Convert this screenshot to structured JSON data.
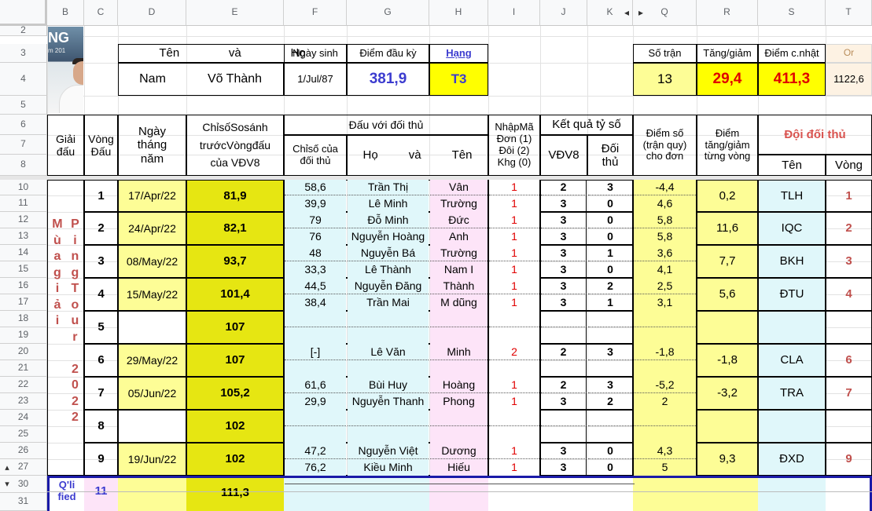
{
  "colors": {
    "yellow": "#ffff00",
    "light_yellow": "#fdfd96",
    "gold": "#e6e612",
    "cyan": "#e0f7fa",
    "peach": "#fdf2e3",
    "pink": "#fde4f8",
    "red": "#e00000",
    "blue": "#3c3ccf",
    "maroon": "#c0504d",
    "frozen_line": "#cccccc",
    "selection": "#1a1aa8"
  },
  "columns": [
    "B",
    "C",
    "D",
    "E",
    "F",
    "G",
    "H",
    "I",
    "J",
    "K",
    "Q",
    "R",
    "S",
    "T"
  ],
  "rows": [
    "2",
    "3",
    "4",
    "5",
    "6",
    "7",
    "8",
    "10",
    "11",
    "12",
    "13",
    "14",
    "15",
    "16",
    "17",
    "18",
    "19",
    "20",
    "21",
    "22",
    "23",
    "24",
    "25",
    "26",
    "27",
    "30",
    "31"
  ],
  "icons": {
    "hidden_cols_left": "◂",
    "hidden_cols_right": "▸",
    "row_group_expand": "▴",
    "row_group_collapse": "▾"
  },
  "player": {
    "photo_text": "NG",
    "photo_sub": "m 201",
    "name_label": "Tên",
    "and_label": "và",
    "surname_label": "Họ",
    "name": "Nam",
    "surname": "Võ Thành",
    "dob_label": "Ngày sinh",
    "dob": "1/Jul/87",
    "start_points_label": "Điểm đầu kỳ",
    "start_points": "381,9",
    "rank_label": "Hạng",
    "rank": "T3"
  },
  "summary": {
    "matches_label": "Số trận",
    "matches": "13",
    "change_label": "Tăng/giảm",
    "change": "29,4",
    "updated_label": "Điểm c.nhật",
    "updated": "411,3",
    "or_label": "Or",
    "or_value": "1122,6"
  },
  "headers": {
    "tournament": "Giải đấu",
    "round": "Vòng Đấu",
    "date": "Ngày tháng năm",
    "index": "ChỉsốSosánh trướcVòngđấu của VĐV8",
    "vs_opponent": "Đấu với đối thủ",
    "opp_index": "Chỉsố của đối thủ",
    "ho": "Họ",
    "va": "và",
    "ten": "Tên",
    "input_code": "NhậpMã Đơn (1) Đôi (2) Khg (0)",
    "result": "Kết quả tỷ số",
    "vdv8": "VĐV8",
    "opp": "Đối thủ",
    "points": "Điểm số (trận quy) cho đơn",
    "per_round": "Điểm tăng/giảm từng vòng",
    "opp_team": "Đội đối thủ",
    "team_name": "Tên",
    "team_round": "Vòng"
  },
  "tournament_letters": [
    "M",
    "ù",
    "a",
    "g",
    "i",
    "ả",
    "i"
  ],
  "tournament_letters2": [
    "P",
    "i",
    "n",
    "g",
    "T",
    "o",
    "u",
    "r",
    "",
    "2",
    "0",
    "2",
    "2"
  ],
  "qualified_label": "Q'li fied",
  "qualified_round": "11",
  "qualified_index": "111,3",
  "rounds": [
    {
      "round": "1",
      "date": "17/Apr/22",
      "index": "81,9",
      "change": "0,2",
      "team": "TLH",
      "team_round": "1",
      "matches": [
        {
          "opp_index": "58,6",
          "ho": "Trần Thị",
          "ten": "Vân",
          "code": "1",
          "a": "2",
          "b": "3",
          "pts": "-4,4"
        },
        {
          "opp_index": "39,9",
          "ho": "Lê Minh",
          "ten": "Trường",
          "code": "1",
          "a": "3",
          "b": "0",
          "pts": "4,6"
        }
      ]
    },
    {
      "round": "2",
      "date": "24/Apr/22",
      "index": "82,1",
      "change": "11,6",
      "team": "IQC",
      "team_round": "2",
      "matches": [
        {
          "opp_index": "79",
          "ho": "Đỗ Minh",
          "ten": "Đức",
          "code": "1",
          "a": "3",
          "b": "0",
          "pts": "5,8"
        },
        {
          "opp_index": "76",
          "ho": "Nguyễn Hoàng",
          "ten": "Anh",
          "code": "1",
          "a": "3",
          "b": "0",
          "pts": "5,8"
        }
      ]
    },
    {
      "round": "3",
      "date": "08/May/22",
      "index": "93,7",
      "change": "7,7",
      "team": "BKH",
      "team_round": "3",
      "matches": [
        {
          "opp_index": "48",
          "ho": "Nguyễn Bá",
          "ten": "Trường",
          "code": "1",
          "a": "3",
          "b": "1",
          "pts": "3,6"
        },
        {
          "opp_index": "33,3",
          "ho": "Lê Thành",
          "ten": "Nam I",
          "code": "1",
          "a": "3",
          "b": "0",
          "pts": "4,1"
        }
      ]
    },
    {
      "round": "4",
      "date": "15/May/22",
      "index": "101,4",
      "change": "5,6",
      "team": "ĐTU",
      "team_round": "4",
      "matches": [
        {
          "opp_index": "44,5",
          "ho": "Nguyễn Đăng",
          "ten": "Thành",
          "code": "1",
          "a": "3",
          "b": "2",
          "pts": "2,5"
        },
        {
          "opp_index": "38,4",
          "ho": "Trần Mai",
          "ten": "M dũng",
          "code": "1",
          "a": "3",
          "b": "1",
          "pts": "3,1"
        }
      ]
    },
    {
      "round": "5",
      "date": "",
      "index": "107",
      "change": "",
      "team": "",
      "team_round": "",
      "matches": [
        {
          "opp_index": "",
          "ho": "",
          "ten": "",
          "code": "",
          "a": "",
          "b": "",
          "pts": ""
        },
        {
          "opp_index": "",
          "ho": "",
          "ten": "",
          "code": "",
          "a": "",
          "b": "",
          "pts": ""
        }
      ]
    },
    {
      "round": "6",
      "date": "29/May/22",
      "index": "107",
      "change": "-1,8",
      "team": "CLA",
      "team_round": "6",
      "matches": [
        {
          "opp_index": "[-]",
          "ho": "Lê Văn",
          "ten": "Minh",
          "code": "2",
          "a": "2",
          "b": "3",
          "pts": "-1,8"
        },
        {
          "opp_index": "",
          "ho": "",
          "ten": "",
          "code": "",
          "a": "",
          "b": "",
          "pts": ""
        }
      ]
    },
    {
      "round": "7",
      "date": "05/Jun/22",
      "index": "105,2",
      "change": "-3,2",
      "team": "TRA",
      "team_round": "7",
      "matches": [
        {
          "opp_index": "61,6",
          "ho": "Bùi Huy",
          "ten": "Hoàng",
          "code": "1",
          "a": "2",
          "b": "3",
          "pts": "-5,2"
        },
        {
          "opp_index": "29,9",
          "ho": "Nguyễn Thanh",
          "ten": "Phong",
          "code": "1",
          "a": "3",
          "b": "2",
          "pts": "2"
        }
      ]
    },
    {
      "round": "8",
      "date": "",
      "index": "102",
      "change": "",
      "team": "",
      "team_round": "",
      "matches": [
        {
          "opp_index": "",
          "ho": "",
          "ten": "",
          "code": "",
          "a": "",
          "b": "",
          "pts": ""
        },
        {
          "opp_index": "",
          "ho": "",
          "ten": "",
          "code": "",
          "a": "",
          "b": "",
          "pts": ""
        }
      ]
    },
    {
      "round": "9",
      "date": "19/Jun/22",
      "index": "102",
      "change": "9,3",
      "team": "ĐXD",
      "team_round": "9",
      "matches": [
        {
          "opp_index": "47,2",
          "ho": "Nguyễn Việt",
          "ten": "Dương",
          "code": "1",
          "a": "3",
          "b": "0",
          "pts": "4,3"
        },
        {
          "opp_index": "76,2",
          "ho": "Kiều Minh",
          "ten": "Hiếu",
          "code": "1",
          "a": "3",
          "b": "0",
          "pts": "5"
        }
      ]
    }
  ]
}
